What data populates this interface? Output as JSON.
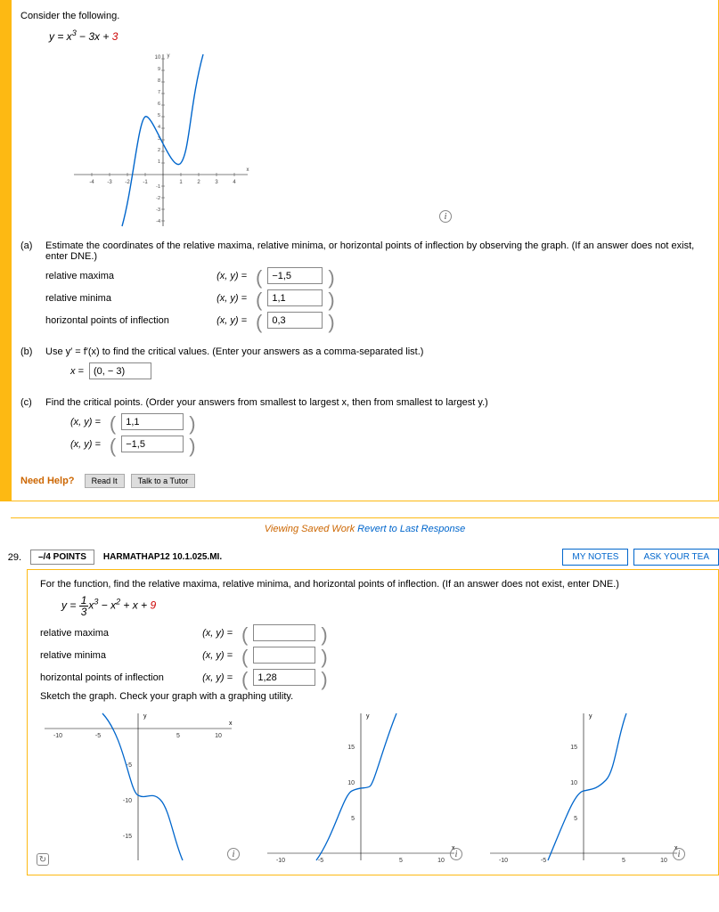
{
  "q28": {
    "header_text": "Consider the following.",
    "equation_html": "y = x<sup>3</sup> − 3x + <span class='red'>3</span>",
    "partA": {
      "text": "Estimate the coordinates of the relative maxima, relative minima, or horizontal points of inflection by observing the graph. (If an answer does not exist, enter DNE.)",
      "relmax_label": "relative maxima",
      "relmin_label": "relative minima",
      "hpi_label": "horizontal points of inflection",
      "xy_label": "(x, y)  =",
      "relmax_val": "−1,5",
      "relmin_val": "1,1",
      "hpi_val": "0,3"
    },
    "partB": {
      "text": "Use y′ = f′(x) to find the critical values. (Enter your answers as a comma-separated list.)",
      "x_label": "x =",
      "val": "(0, − 3)"
    },
    "partC": {
      "text": "Find the critical points. (Order your answers from smallest to largest x, then from smallest to largest y.)",
      "xy_label": "(x, y)  =",
      "val1": "1,1",
      "val2": "−1,5"
    },
    "need_help": "Need Help?",
    "read_it": "Read It",
    "talk_tutor": "Talk to a Tutor",
    "saved_work": "Viewing Saved Work ",
    "revert": "Revert to Last Response"
  },
  "q29": {
    "num": "29.",
    "points": "–/4 POINTS",
    "assign": "HARMATHAP12 10.1.025.MI.",
    "mynotes": "MY NOTES",
    "askteacher": "ASK YOUR TEA",
    "prompt": "For the function, find the relative maxima, relative minima, and horizontal points of inflection. (If an answer does not exist, enter DNE.)",
    "equation_html": "y = <span style='display:inline-block;vertical-align:middle;text-align:center;line-height:1'><span style='display:block;border-bottom:1px solid #000;padding:0 2px'>1</span><span style='display:block;padding:0 2px'>3</span></span>x<sup>3</sup> − x<sup>2</sup> + x + <span class='red'>9</span>",
    "relmax_label": "relative maxima",
    "relmin_label": "relative minima",
    "hpi_label": "horizontal points of inflection",
    "xy_label": "(x, y) =",
    "hpi_val": "1,28",
    "sketch": "Sketch the graph. Check your graph with a graphing utility."
  },
  "chart_data": [
    {
      "type": "line",
      "title": "y = x^3 - 3x + 3",
      "xlabel": "x",
      "ylabel": "y",
      "xlim": [
        -4,
        4
      ],
      "ylim": [
        -4,
        10
      ],
      "series": [
        {
          "name": "curve",
          "equation": "x^3 - 3x + 3"
        }
      ],
      "xticks": [
        -4,
        -3,
        -2,
        -1,
        1,
        2,
        3,
        4
      ],
      "yticks": [
        -4,
        -3,
        -2,
        -1,
        1,
        2,
        3,
        4,
        5,
        6,
        7,
        8,
        9,
        10
      ]
    },
    {
      "type": "line",
      "xlim": [
        -10,
        10
      ],
      "ylim": [
        -18,
        2
      ],
      "xticks": [
        -10,
        -5,
        5,
        10
      ],
      "yticks": [
        -5,
        -10,
        -15
      ],
      "xlabel": "x",
      "ylabel": "y"
    },
    {
      "type": "line",
      "xlim": [
        -10,
        10
      ],
      "ylim": [
        0,
        18
      ],
      "xticks": [
        -10,
        -5,
        5,
        10
      ],
      "yticks": [
        5,
        10,
        15
      ],
      "xlabel": "x",
      "ylabel": "y"
    },
    {
      "type": "line",
      "xlim": [
        -10,
        10
      ],
      "ylim": [
        0,
        18
      ],
      "xticks": [
        -10,
        -5,
        5,
        10
      ],
      "yticks": [
        5,
        10,
        15
      ],
      "xlabel": "x",
      "ylabel": "y"
    }
  ]
}
